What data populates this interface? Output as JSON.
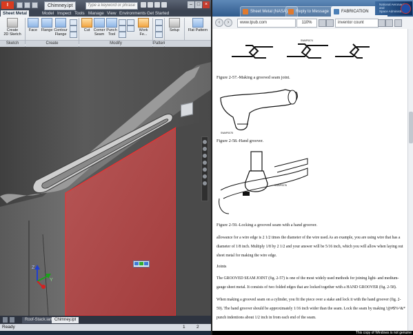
{
  "inventor": {
    "app_logo": "I",
    "document_title": "Chimney.ipt",
    "search_placeholder": "Type a keyword or phrase",
    "tabs": [
      "Sheet Metal",
      "Model",
      "Inspect",
      "Tools",
      "Manage",
      "View",
      "Environments",
      "Get Started"
    ],
    "ribbon": {
      "create_2d_sketch": "Create\n2D Sketch",
      "face": "Face",
      "flange": "Flange",
      "contour_flange": "Contour\nFlange",
      "cut": "Cut",
      "corner_seam": "Corner\nSeam",
      "punch_tool": "Punch\nTool",
      "work_features": "Work Fe...",
      "setup": "Setup",
      "flat_pattern": "Flat Pattern",
      "panels": [
        "Sketch",
        "Create",
        "Modify",
        "Pattern"
      ]
    },
    "doc_tabs": [
      "Roof-Stack.iam",
      "Chimney.ipt"
    ],
    "status": "Ready",
    "status_numbers": [
      "1",
      "2"
    ]
  },
  "browser": {
    "tabs": [
      {
        "label": "Sheet Metal (NASA)..."
      },
      {
        "label": "Reply to Message"
      },
      {
        "label": "FABRICATION"
      }
    ],
    "url": "www.tpub.com",
    "zoom": "110%",
    "find": "inventor count",
    "nasa_subtitle": "National Aeronautics and\nSpace Administration"
  },
  "document": {
    "fig1_labels": [
      "SWAP0074"
    ],
    "fig1_caption": "Figure 2-57.-Making a grooved seam joint.",
    "fig2_label": "SWAP0075",
    "fig2_caption": "Figure 2-58.-Hand groover.",
    "fig3_label": "SWAP0076",
    "fig3_caption": "Figure 2-59.-Locking a grooved seam with a hand groover.",
    "para1": "allowance for a wire edge is 2 1/2 times the diameter of the wire used.As an example, you are using wire that has a diameter of 1/8 inch. Multiply 1/8 by 2 1/2 and your answer will be 5/16 inch, which you will allow when laying out sheet metal for making the wire edge.",
    "heading": "Joints",
    "para2": "The GROOVED SEAM JOINT (fig. 2-57) is one of the most widely used methods for joining light- and medium-gauge sheet metal. It consists of two folded edges that are locked together with a HAND GROOVER (fig. 2-58).",
    "para3": "When making a grooved seam on a cylinder, you fit the piece over a stake and lock it with the hand groover (fig. 2-59). The hand groover should be approximately 1/16 inch wider than the seam. Lock the seam by making !@#$%^&* punch indentions about 1/2 inch in from each end of the seam."
  },
  "windows_notice": "This copy of Windows is not genuine",
  "colors": {
    "face_red": "#b04646",
    "edge_red": "#ff2a2a",
    "axis_x": "#d42020",
    "axis_y": "#1aa31a",
    "axis_z": "#1f3fd1"
  }
}
